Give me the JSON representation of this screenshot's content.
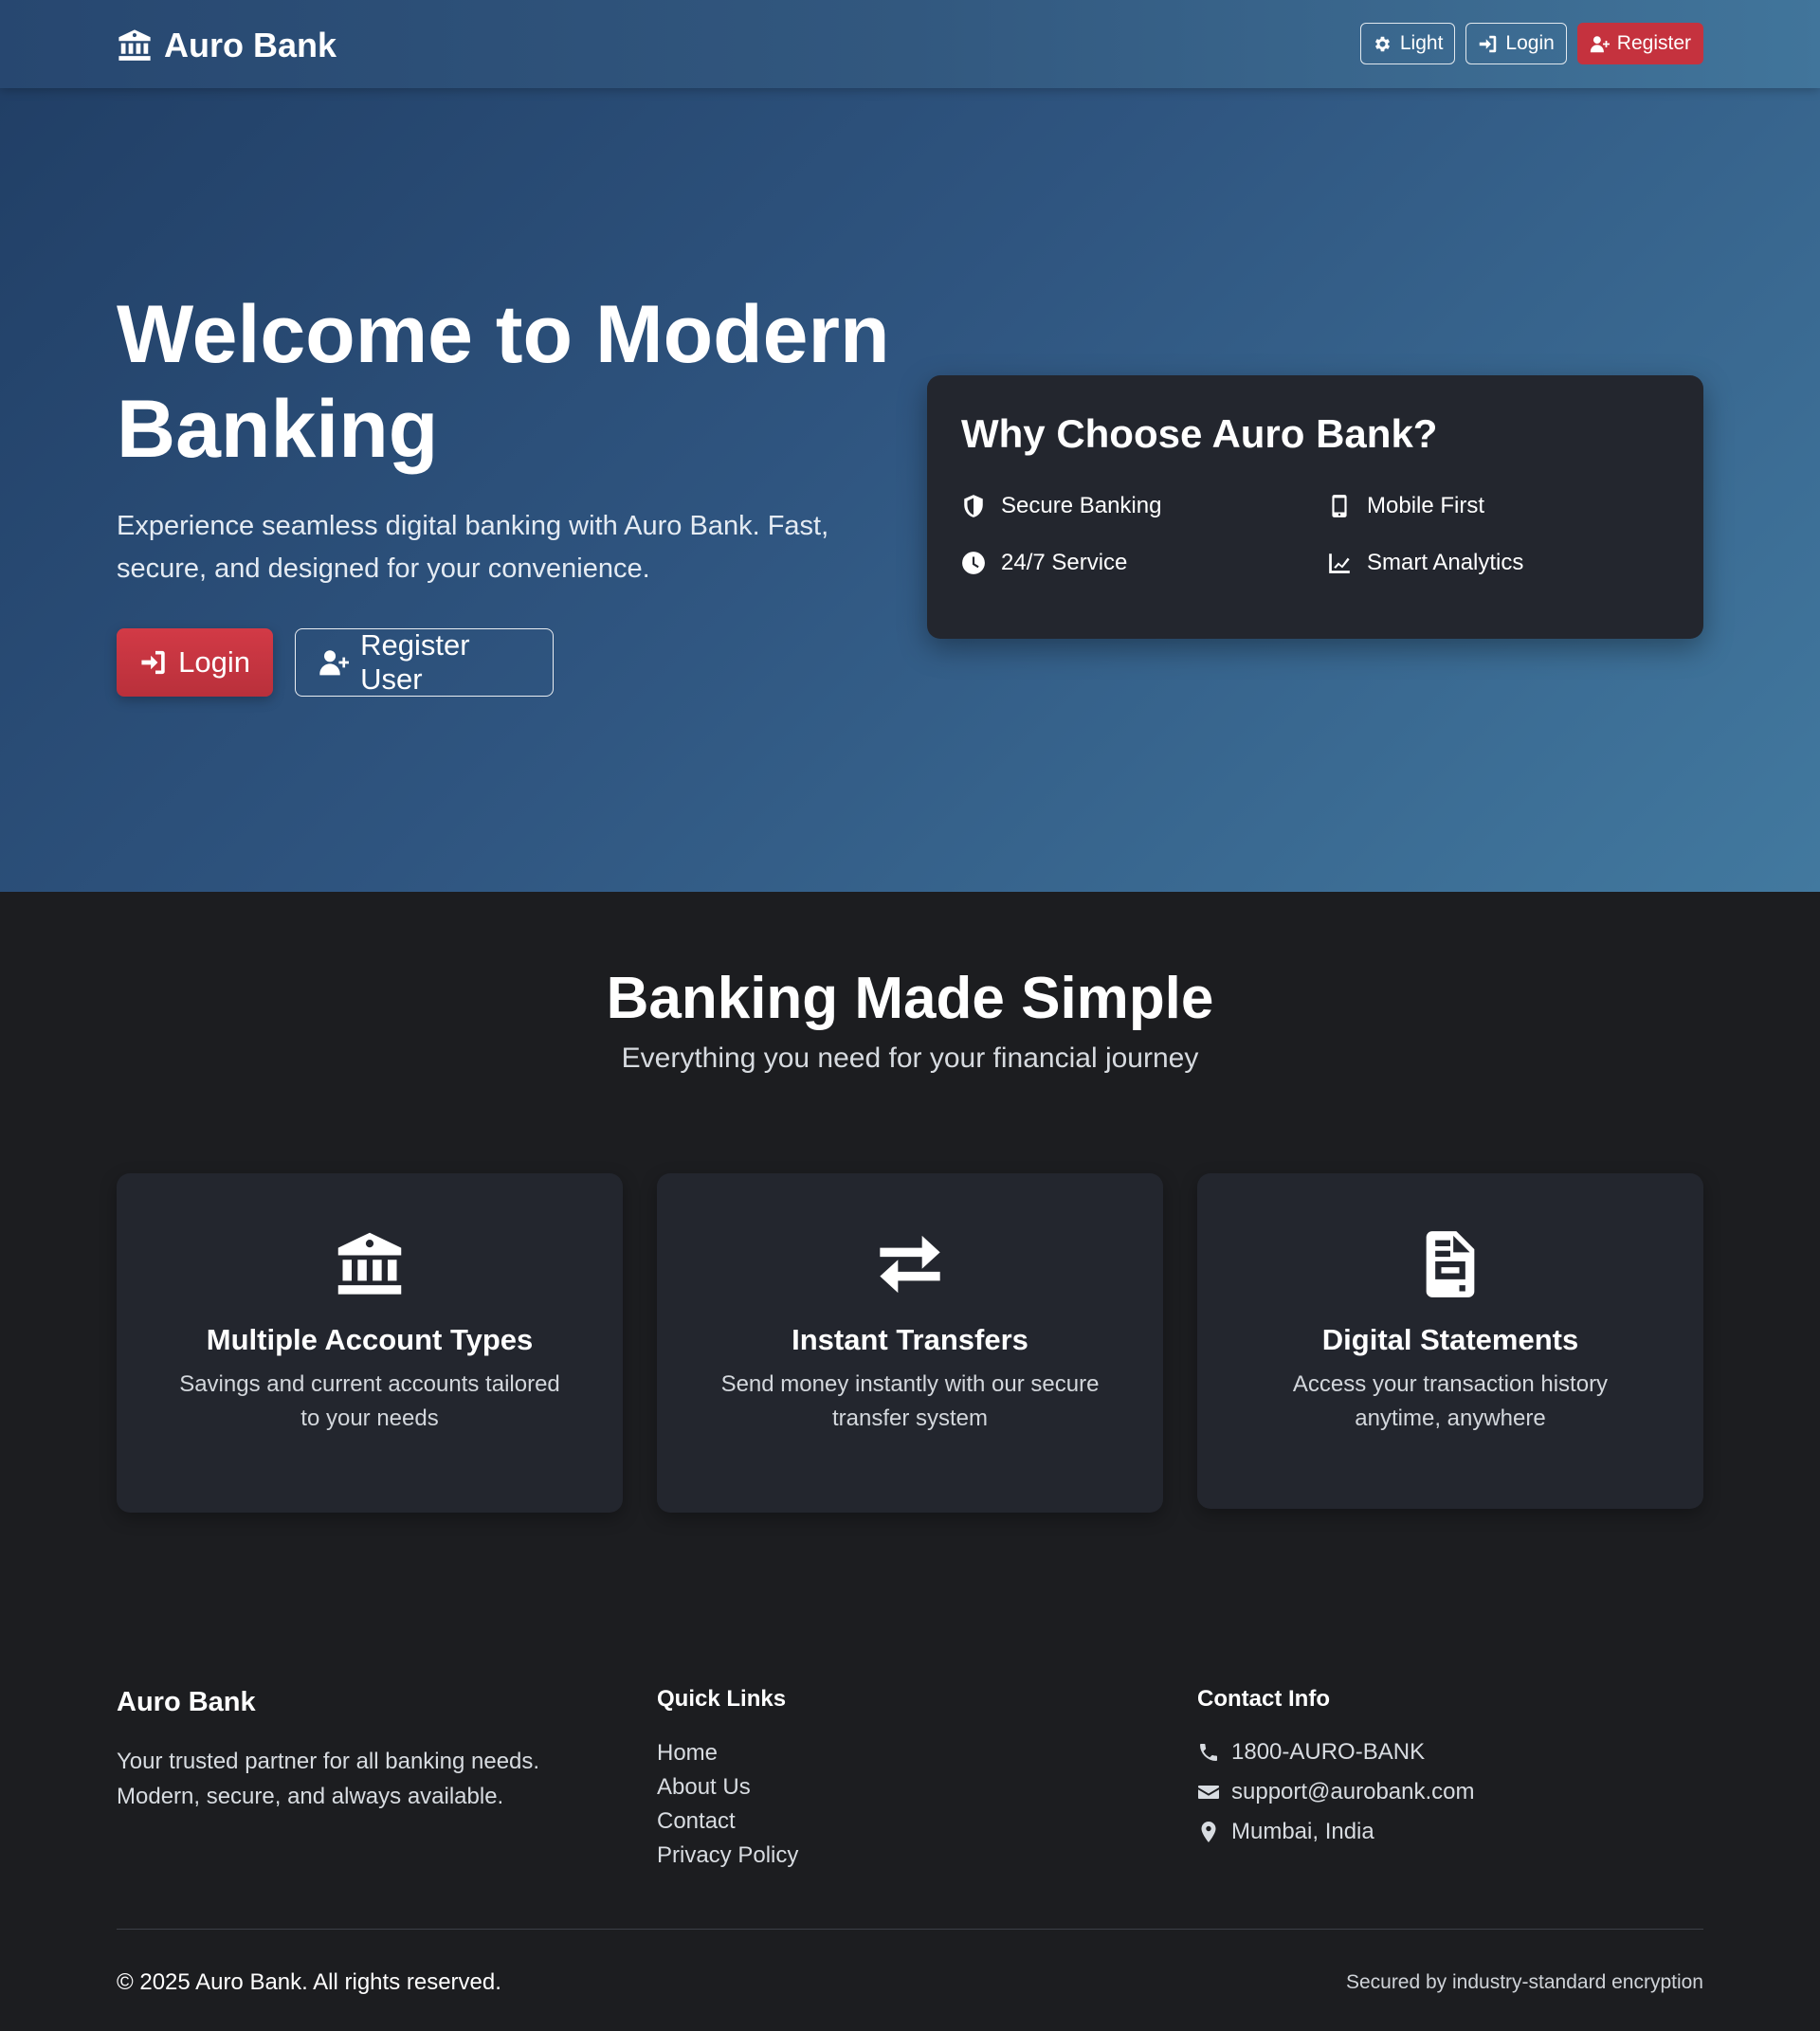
{
  "navbar": {
    "brand": "Auro Bank",
    "buttons": [
      {
        "label": "Light",
        "icon": "gear-icon"
      },
      {
        "label": "Login",
        "icon": "sign-in-icon"
      },
      {
        "label": "Register",
        "icon": "user-plus-icon"
      }
    ]
  },
  "hero": {
    "title": "Welcome to Modern Banking",
    "subtitle": "Experience seamless digital banking with Auro Bank. Fast, secure, and designed for your convenience.",
    "login_label": "Login",
    "register_label": "Register User"
  },
  "why": {
    "title": "Why Choose Auro Bank?",
    "items": [
      {
        "label": "Secure Banking",
        "icon": "shield-icon"
      },
      {
        "label": "Mobile First",
        "icon": "mobile-icon"
      },
      {
        "label": "24/7 Service",
        "icon": "clock-icon"
      },
      {
        "label": "Smart Analytics",
        "icon": "chart-line-icon"
      }
    ]
  },
  "features": {
    "title": "Banking Made Simple",
    "subtitle": "Everything you need for your financial journey",
    "cards": [
      {
        "title": "Multiple Account Types",
        "description": "Savings and current accounts tailored to your needs",
        "icon": "bank-icon"
      },
      {
        "title": "Instant Transfers",
        "description": "Send money instantly with our secure transfer system",
        "icon": "exchange-icon"
      },
      {
        "title": "Digital Statements",
        "description": "Access your transaction history anytime, anywhere",
        "icon": "invoice-icon"
      }
    ]
  },
  "footer": {
    "brand": "Auro Bank",
    "about": "Your trusted partner for all banking needs. Modern, secure, and always available.",
    "quick_links_title": "Quick Links",
    "quick_links": [
      "Home",
      "About Us",
      "Contact",
      "Privacy Policy"
    ],
    "contact_title": "Contact Info",
    "contact": [
      {
        "text": "1800-AURO-BANK",
        "icon": "phone-icon"
      },
      {
        "text": "support@aurobank.com",
        "icon": "envelope-icon"
      },
      {
        "text": "Mumbai, India",
        "icon": "map-marker-icon"
      }
    ],
    "copyright": "© 2025 Auro Bank. All rights reserved.",
    "secured": "Secured by industry-standard encryption"
  }
}
